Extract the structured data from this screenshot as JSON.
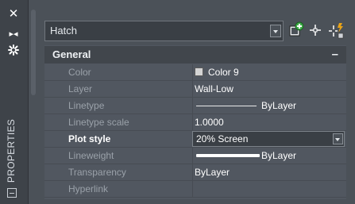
{
  "palette": {
    "title": "PROPERTIES",
    "close_glyph": "✕",
    "autohide_glyph": "▸◂",
    "menu_glyph": "⌘"
  },
  "object_selector": {
    "value": "Hatch"
  },
  "toolbar": {
    "icons": [
      "toggle-pickadd-icon",
      "select-objects-icon",
      "quick-select-icon"
    ]
  },
  "section": {
    "title": "General",
    "collapse_glyph": "–"
  },
  "properties": [
    {
      "name": "Color",
      "value": "Color 9"
    },
    {
      "name": "Layer",
      "value": "Wall-Low"
    },
    {
      "name": "Linetype",
      "value": "ByLayer"
    },
    {
      "name": "Linetype scale",
      "value": "1.0000"
    },
    {
      "name": "Plot style",
      "value": "20% Screen"
    },
    {
      "name": "Lineweight",
      "value": "ByLayer"
    },
    {
      "name": "Transparency",
      "value": "ByLayer"
    },
    {
      "name": "Hyperlink",
      "value": ""
    }
  ],
  "colors": {
    "panel_bg": "#4b5158",
    "grid_bg": "#515760",
    "header_bg": "#41464c",
    "label_dim": "#9aa1a9",
    "accent_green": "#3fae49",
    "accent_gold": "#e8a317"
  }
}
